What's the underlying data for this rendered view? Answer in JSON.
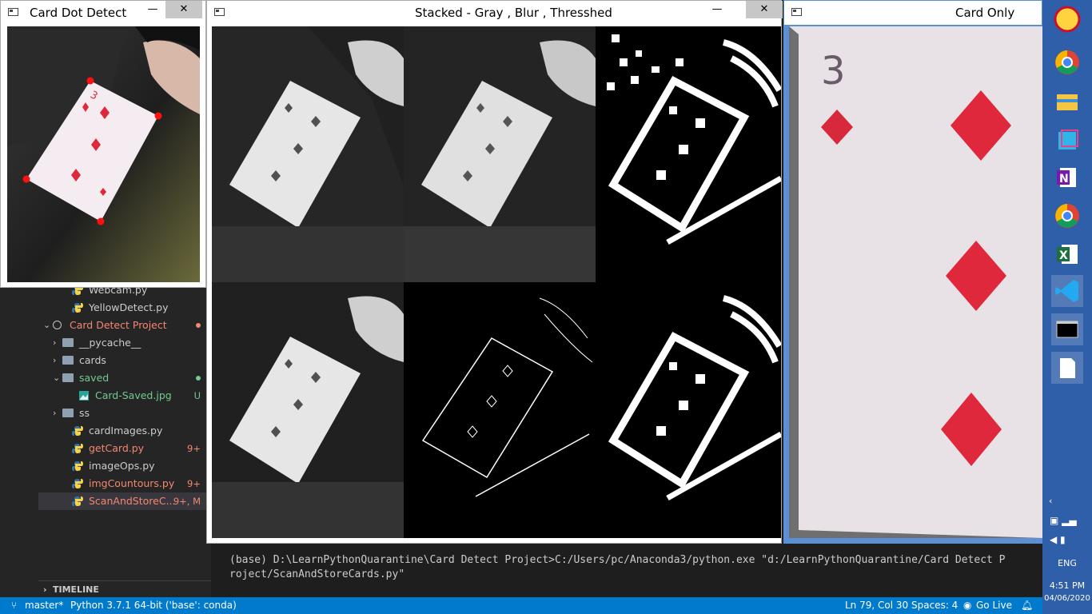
{
  "explorer": {
    "items": [
      {
        "label": "Webcam.py",
        "type": "py",
        "badge": "",
        "color": "#cccccc"
      },
      {
        "label": "YellowDetect.py",
        "type": "py",
        "badge": "",
        "color": "#cccccc"
      },
      {
        "label": "Card Detect Project",
        "type": "folder-open",
        "badge": "",
        "color": "#f48771"
      },
      {
        "label": "__pycache__",
        "type": "folder",
        "badge": "",
        "color": "#cccccc"
      },
      {
        "label": "cards",
        "type": "folder",
        "badge": "",
        "color": "#cccccc"
      },
      {
        "label": "saved",
        "type": "folder-open",
        "badge": "",
        "color": "#73c991"
      },
      {
        "label": "Card-Saved.jpg",
        "type": "image",
        "badge": "U",
        "color": "#73c991"
      },
      {
        "label": "ss",
        "type": "folder",
        "badge": "",
        "color": "#cccccc"
      },
      {
        "label": "cardImages.py",
        "type": "py",
        "badge": "",
        "color": "#cccccc"
      },
      {
        "label": "getCard.py",
        "type": "py",
        "badge": "9+",
        "color": "#f48771"
      },
      {
        "label": "imageOps.py",
        "type": "py",
        "badge": "",
        "color": "#cccccc"
      },
      {
        "label": "imgCountours.py",
        "type": "py",
        "badge": "9+",
        "color": "#f48771"
      },
      {
        "label": "ScanAndStoreC...",
        "type": "py",
        "badge": "9+, M",
        "color": "#f48771"
      }
    ],
    "timeline_label": "TIMELINE"
  },
  "windows": {
    "dot_detect": {
      "title": "Card Dot Detect"
    },
    "stacked": {
      "title": "Stacked - Gray , Blur , Thresshed"
    },
    "card_only": {
      "title": "Card Only"
    }
  },
  "window_controls": {
    "minimize": "—",
    "maximize": "☐",
    "close": "✕"
  },
  "terminal": {
    "line1": "(base) D:\\LearnPythonQuarantine\\Card Detect Project>C:/Users/pc/Anaconda3/python.exe \"d:/LearnPythonQuarantine/Card Detect P",
    "line2": "roject/ScanAndStoreCards.py\""
  },
  "statusbar": {
    "branch": "master*",
    "interpreter": "Python 3.7.1 64-bit ('base': conda)",
    "position": "Ln 79, Col 30",
    "spaces": "Spaces: 4",
    "golive": "Go Live"
  },
  "taskbar": {
    "language": "ENG",
    "time": "4:51 PM",
    "date": "04/06/2020"
  },
  "card": {
    "rank": "3"
  },
  "colors": {
    "accent": "#007acc",
    "taskbar": "#2f5fa8",
    "diamond": "#e0283c"
  }
}
